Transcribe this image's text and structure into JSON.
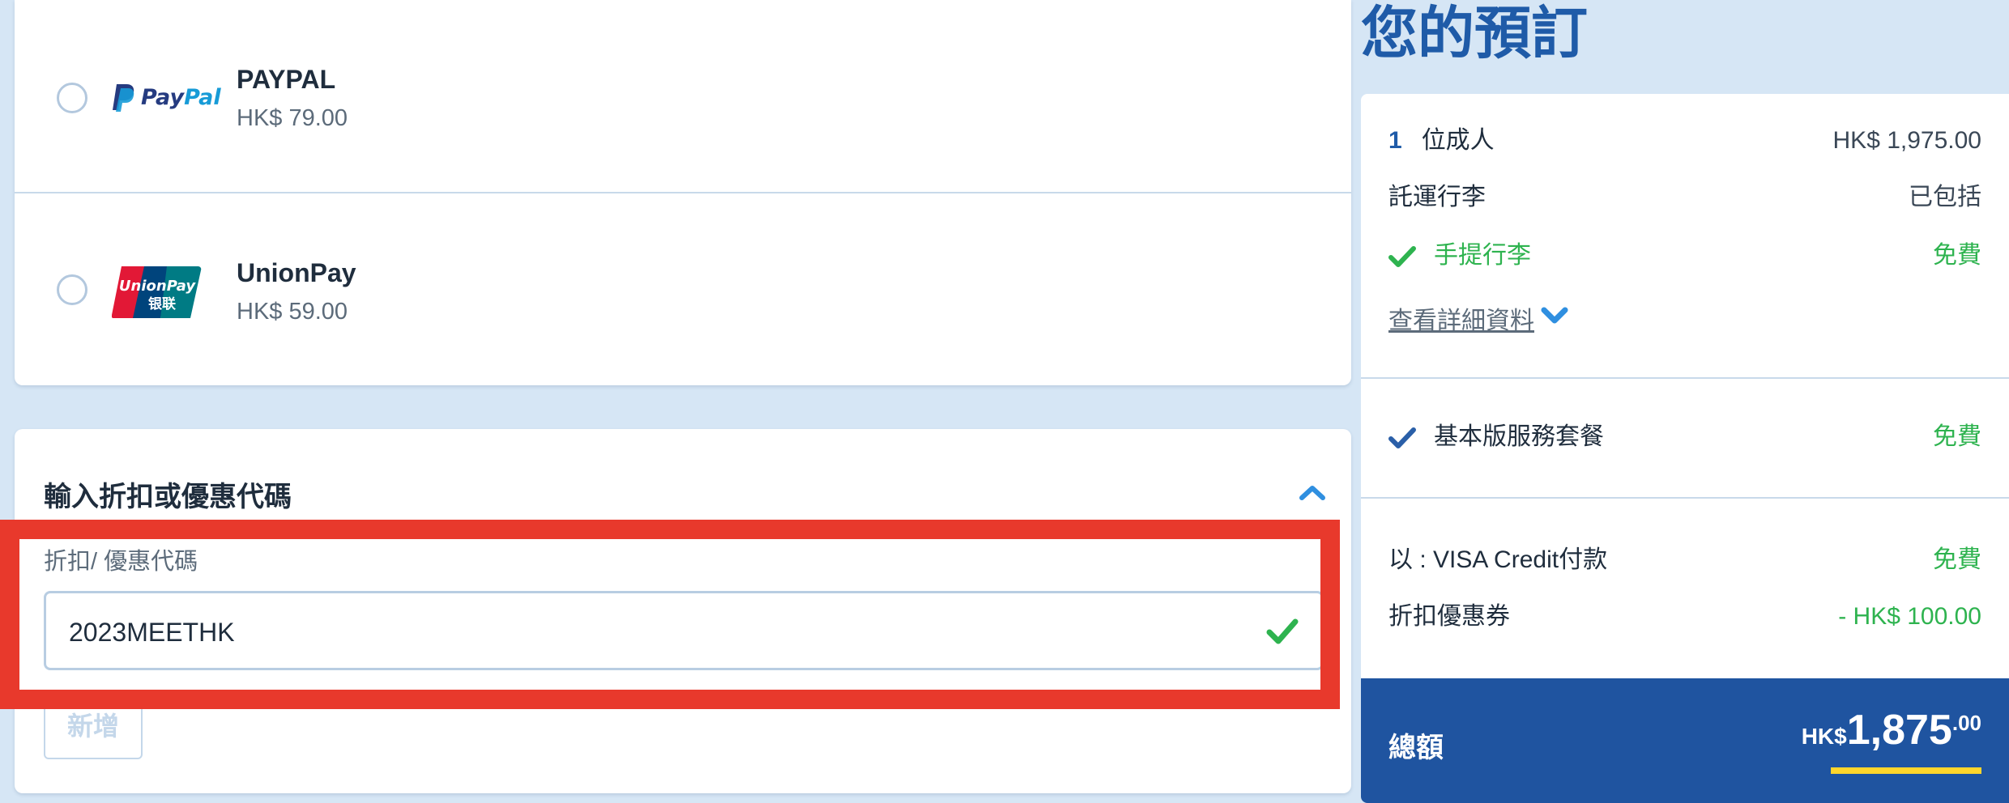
{
  "payment_methods": [
    {
      "name": "PAYPAL",
      "price": "HK$ 79.00",
      "logo_text": "PayPal",
      "icon": "paypal-icon"
    },
    {
      "name": "UnionPay",
      "price": "HK$ 59.00",
      "logo_text_top": "UnionPay",
      "logo_text_bottom": "银联",
      "icon": "unionpay-icon"
    }
  ],
  "promo": {
    "title": "輸入折扣或優惠代碼",
    "field_label": "折扣/ 優惠代碼",
    "code_value": "2023MEETHK",
    "add_button": "新增",
    "expanded_icon": "chevron-up-icon",
    "valid_icon": "check-icon"
  },
  "summary": {
    "title": "您的預訂",
    "passengers_count": "1",
    "passengers_label": "位成人",
    "passengers_price": "HK$ 1,975.00",
    "checked_baggage_label": "託運行李",
    "checked_baggage_value": "已包括",
    "carry_on_label": "手提行李",
    "carry_on_value": "免費",
    "details_link": "查看詳細資料",
    "service_package_label": "基本版服務套餐",
    "service_package_value": "免費",
    "payment_label": "以 : VISA Credit付款",
    "payment_value": "免費",
    "discount_label": "折扣優惠券",
    "discount_value": "- HK$ 100.00",
    "total_label": "總額",
    "total_currency": "HK$",
    "total_amount": "1,875",
    "total_decimals": ".00"
  },
  "colors": {
    "background": "#d6e6f5",
    "brand_blue": "#1f54a0",
    "accent_green": "#2eb34f",
    "highlight_red": "#e8392c",
    "total_underline": "#ffd62b"
  }
}
